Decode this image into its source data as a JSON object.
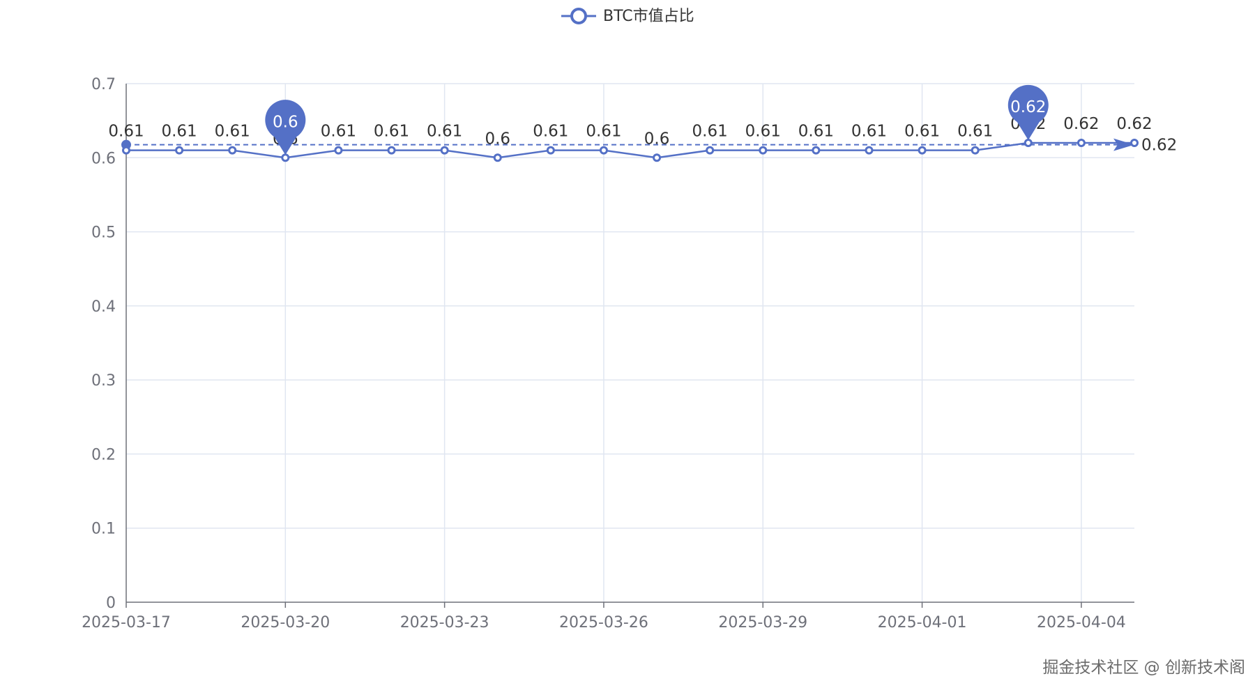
{
  "chart_data": {
    "type": "line",
    "legend": {
      "label": "BTC市值占比",
      "position": "top-center"
    },
    "x": [
      "2025-03-17",
      "2025-03-18",
      "2025-03-19",
      "2025-03-20",
      "2025-03-21",
      "2025-03-22",
      "2025-03-23",
      "2025-03-24",
      "2025-03-25",
      "2025-03-26",
      "2025-03-27",
      "2025-03-28",
      "2025-03-29",
      "2025-03-30",
      "2025-03-31",
      "2025-04-01",
      "2025-04-02",
      "2025-04-03",
      "2025-04-04",
      "2025-04-05"
    ],
    "x_tick_labels": [
      "2025-03-17",
      "2025-03-20",
      "2025-03-23",
      "2025-03-26",
      "2025-03-29",
      "2025-04-01",
      "2025-04-04"
    ],
    "series": [
      {
        "name": "BTC市值占比",
        "values": [
          0.61,
          0.61,
          0.61,
          0.6,
          0.61,
          0.61,
          0.61,
          0.6,
          0.61,
          0.61,
          0.6,
          0.61,
          0.61,
          0.61,
          0.61,
          0.61,
          0.61,
          0.62,
          0.62,
          0.62
        ],
        "point_labels": [
          "0.61",
          "0.61",
          "0.61",
          "0.6",
          "0.61",
          "0.61",
          "0.61",
          "0.6",
          "0.61",
          "0.61",
          "0.6",
          "0.61",
          "0.61",
          "0.61",
          "0.61",
          "0.61",
          "0.61",
          "0.62",
          "0.62",
          "0.62"
        ]
      }
    ],
    "mark_points": [
      {
        "type": "min",
        "index": 3,
        "label": "0.6"
      },
      {
        "type": "max",
        "index": 17,
        "label": "0.62"
      }
    ],
    "mark_line": {
      "type": "average",
      "value": 0.6175,
      "label": "0.62"
    },
    "y_ticks": [
      "0",
      "0.1",
      "0.2",
      "0.3",
      "0.4",
      "0.5",
      "0.6",
      "0.7"
    ],
    "ylim": [
      0,
      0.7
    ],
    "grid": true,
    "colors": {
      "series": "#5470c6",
      "grid": "#e0e6f1",
      "axis": "#6e7079",
      "label": "#333333"
    }
  },
  "watermark": "掘金技术社区 @ 创新技术阁"
}
